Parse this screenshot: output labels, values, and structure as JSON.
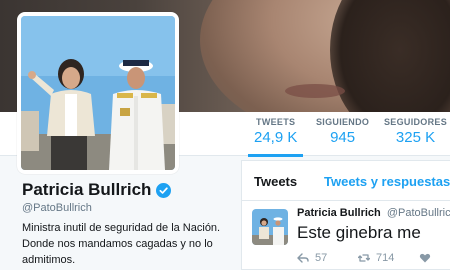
{
  "stats": [
    {
      "label": "TWEETS",
      "value": "24,9 K"
    },
    {
      "label": "SIGUIENDO",
      "value": "945"
    },
    {
      "label": "SEGUIDORES",
      "value": "325 K"
    }
  ],
  "profile": {
    "name": "Patricia Bullrich",
    "handle": "@PatoBullrich",
    "bio_lines": [
      "Ministra inutil de seguridad de la Nación.",
      "Donde nos mandamos cagadas y no lo",
      "admitimos."
    ]
  },
  "timeline": {
    "tabs": [
      "Tweets",
      "Tweets y respuestas"
    ],
    "tweet": {
      "name": "Patricia Bullrich",
      "handle": "@PatoBullrich",
      "text": "Este ginebra me",
      "reply_count": "57",
      "retweet_count": "714",
      "like_count": ""
    }
  },
  "colors": {
    "accent": "#1da1f2",
    "text": "#14171a",
    "muted": "#657786"
  }
}
